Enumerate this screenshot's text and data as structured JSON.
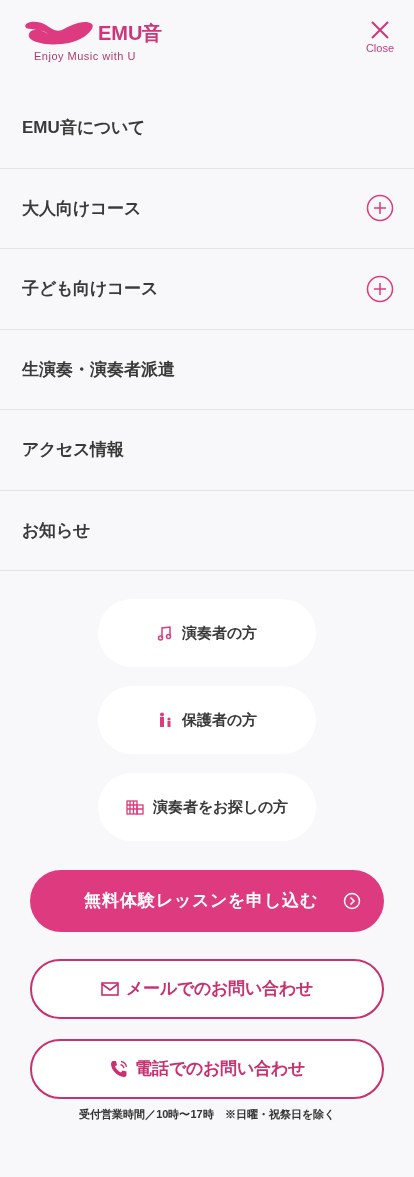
{
  "header": {
    "logo_name": "EMU音",
    "logo_tagline": "Enjoy Music with U",
    "close_label": "Close"
  },
  "menu": [
    {
      "label": "EMU音について",
      "kind": "link"
    },
    {
      "label": "大人向けコース",
      "kind": "group",
      "expanded": false
    },
    {
      "label": "子ども向けコース",
      "kind": "group",
      "expanded": false
    },
    {
      "label": "生演奏・演奏者派遣",
      "kind": "link"
    },
    {
      "label": "アクセス情報",
      "kind": "link"
    },
    {
      "label": "お知らせ",
      "kind": "link"
    }
  ],
  "audience_links": [
    {
      "label": "演奏者の方",
      "kind": "music"
    },
    {
      "label": "保護者の方",
      "kind": "family"
    },
    {
      "label": "演奏者をお探しの方",
      "kind": "building"
    }
  ],
  "cta": {
    "label": "無料体験レッスンを申し込む"
  },
  "contacts": [
    {
      "label": "メールでのお問い合わせ",
      "kind": "mail"
    },
    {
      "label": "電話でのお問い合わせ",
      "kind": "phone"
    }
  ],
  "hours_note": "受付営業時間／10時〜17時　※日曜・祝祭日を除く"
}
